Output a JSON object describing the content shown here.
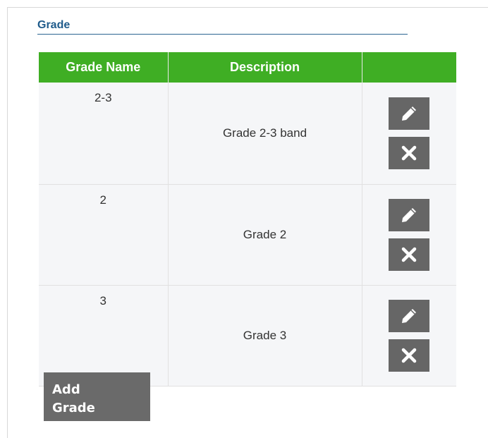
{
  "section": {
    "title": "Grade"
  },
  "table": {
    "headers": [
      "Grade Name",
      "Description",
      ""
    ],
    "rows": [
      {
        "name": "2-3",
        "description": "Grade 2-3 band"
      },
      {
        "name": "2",
        "description": "Grade 2"
      },
      {
        "name": "3",
        "description": "Grade 3"
      }
    ]
  },
  "actions": {
    "edit_icon": "pencil-icon",
    "delete_icon": "x-icon"
  },
  "add_button": {
    "line1": "Add",
    "line2": "Grade"
  },
  "colors": {
    "header_bg": "#3fae24",
    "title_color": "#1f5b8b",
    "button_bg": "#666666",
    "row_bg": "#f5f6f8"
  }
}
